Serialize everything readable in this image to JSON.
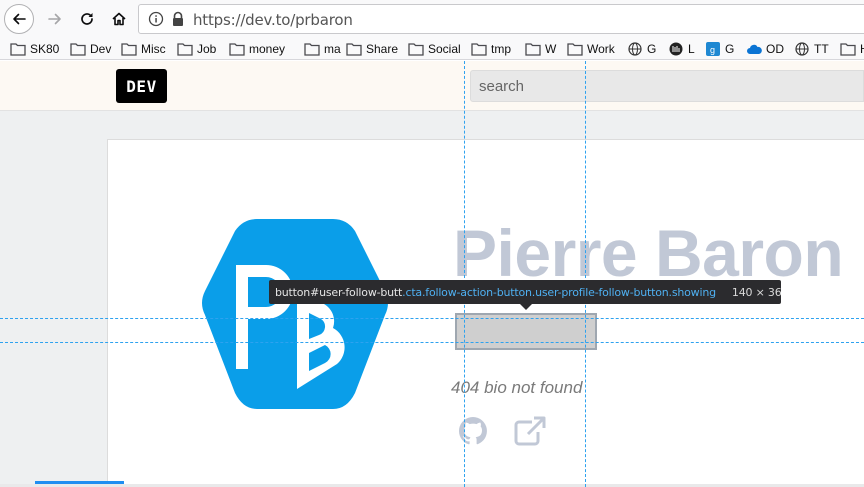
{
  "browser": {
    "url": "https://dev.to/prbaron",
    "bookmarks": [
      "SK80",
      "Dev",
      "Misc",
      "Job",
      "money",
      "ma",
      "Share",
      "Social",
      "tmp",
      "W",
      "Work",
      "G",
      "L",
      "G",
      "OD",
      "TT",
      "H"
    ]
  },
  "site": {
    "logo": "DEV",
    "search_placeholder": "search"
  },
  "profile": {
    "name": "Pierre Baron",
    "bio": "404 bio not found",
    "avatar_initials": "PB",
    "avatar_color": "#0a9ee9"
  },
  "devtools": {
    "element_tag": "button",
    "element_id": "#user-follow-butt",
    "element_classes": ".cta.follow-action-button.user-profile-follow-button.showing",
    "element_dims": "140 × 36",
    "guide_color": "#2ea2ef"
  }
}
